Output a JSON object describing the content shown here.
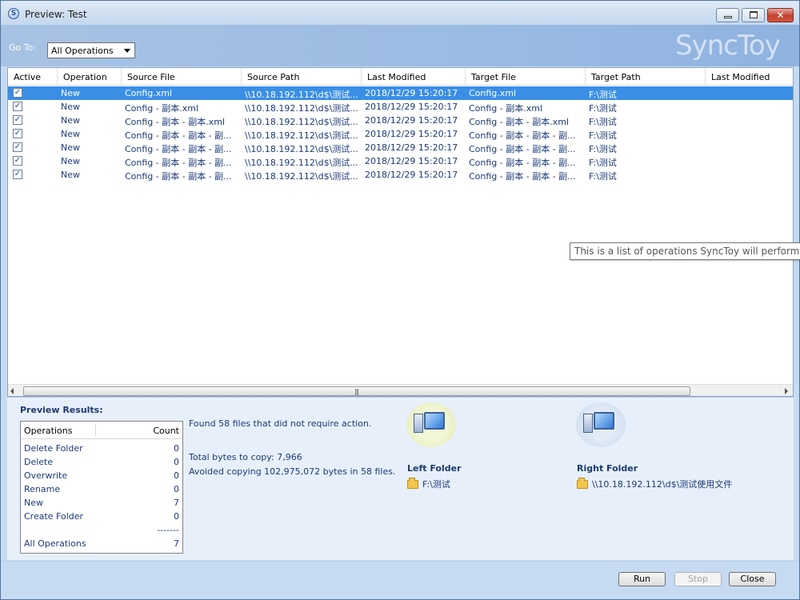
{
  "window": {
    "title": "Preview: Test",
    "brand": "SyncToy"
  },
  "header": {
    "goto_label": "Go To:",
    "goto_value": "All Operations"
  },
  "grid": {
    "columns": [
      "Active",
      "Operation",
      "Source File",
      "Source Path",
      "Last Modified",
      "Target File",
      "Target Path",
      "Last Modified"
    ],
    "rows": [
      {
        "checked": true,
        "operation": "New",
        "source_file": "Config.xml",
        "source_path": "\\\\10.18.192.112\\d$\\测试...",
        "last_modified": "2018/12/29 15:20:17",
        "target_file": "Config.xml",
        "target_path": "F:\\测试"
      },
      {
        "checked": true,
        "operation": "New",
        "source_file": "Config - 副本.xml",
        "source_path": "\\\\10.18.192.112\\d$\\测试...",
        "last_modified": "2018/12/29 15:20:17",
        "target_file": "Config - 副本.xml",
        "target_path": "F:\\测试"
      },
      {
        "checked": true,
        "operation": "New",
        "source_file": "Config - 副本 - 副本.xml",
        "source_path": "\\\\10.18.192.112\\d$\\测试...",
        "last_modified": "2018/12/29 15:20:17",
        "target_file": "Config - 副本 - 副本.xml",
        "target_path": "F:\\测试"
      },
      {
        "checked": true,
        "operation": "New",
        "source_file": "Config - 副本 - 副本 - 副...",
        "source_path": "\\\\10.18.192.112\\d$\\测试...",
        "last_modified": "2018/12/29 15:20:17",
        "target_file": "Config - 副本 - 副本 - 副...",
        "target_path": "F:\\测试"
      },
      {
        "checked": true,
        "operation": "New",
        "source_file": "Config - 副本 - 副本 - 副...",
        "source_path": "\\\\10.18.192.112\\d$\\测试...",
        "last_modified": "2018/12/29 15:20:17",
        "target_file": "Config - 副本 - 副本 - 副...",
        "target_path": "F:\\测试"
      },
      {
        "checked": true,
        "operation": "New",
        "source_file": "Config - 副本 - 副本 - 副...",
        "source_path": "\\\\10.18.192.112\\d$\\测试...",
        "last_modified": "2018/12/29 15:20:17",
        "target_file": "Config - 副本 - 副本 - 副...",
        "target_path": "F:\\测试"
      },
      {
        "checked": true,
        "operation": "New",
        "source_file": "Config - 副本 - 副本 - 副...",
        "source_path": "\\\\10.18.192.112\\d$\\测试...",
        "last_modified": "2018/12/29 15:20:17",
        "target_file": "Config - 副本 - 副本 - 副...",
        "target_path": "F:\\测试"
      }
    ],
    "tooltip": "This is a list of operations SyncToy will perform i"
  },
  "results": {
    "title": "Preview Results:",
    "table_headers": [
      "Operations",
      "Count"
    ],
    "operations": [
      {
        "name": "Delete Folder",
        "count": "0"
      },
      {
        "name": "Delete",
        "count": "0"
      },
      {
        "name": "Overwrite",
        "count": "0"
      },
      {
        "name": "Rename",
        "count": "0"
      },
      {
        "name": "New",
        "count": "7"
      },
      {
        "name": "Create Folder",
        "count": "0"
      }
    ],
    "separator": "-------",
    "total": {
      "name": "All Operations",
      "count": "7"
    },
    "found_text": "Found 58 files that did not require action.",
    "bytes_text": "Total bytes to copy: 7,966",
    "avoided_text": "Avoided copying 102,975,072 bytes in 58 files.",
    "left_folder": {
      "label": "Left Folder",
      "path": "F:\\测试"
    },
    "right_folder": {
      "label": "Right Folder",
      "path": "\\\\10.18.192.112\\d$\\测试使用文件"
    }
  },
  "buttons": {
    "run": "Run",
    "stop": "Stop",
    "close": "Close"
  }
}
